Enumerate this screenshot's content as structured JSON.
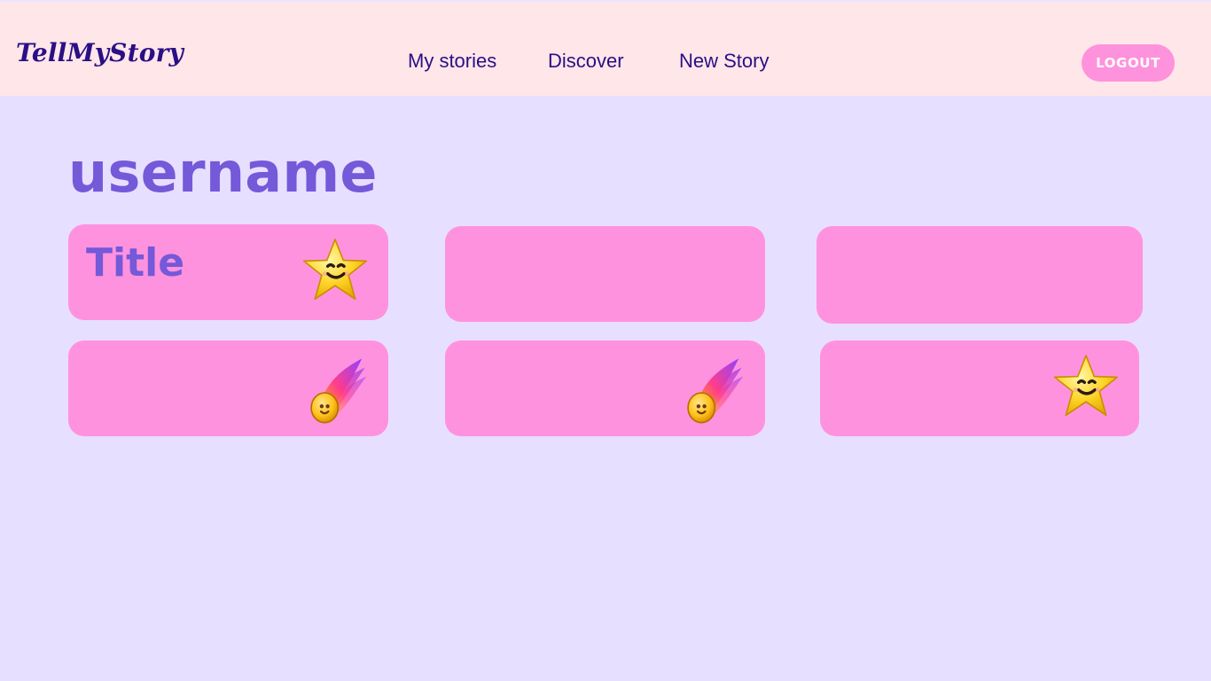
{
  "header": {
    "brand": "TellMyStory",
    "nav": {
      "my_stories": "My stories",
      "discover": "Discover",
      "new_story": "New Story"
    },
    "logout_label": "LOGOUT"
  },
  "profile": {
    "username": "username"
  },
  "stories": [
    {
      "title": "Title",
      "icon": "smiling-star-icon"
    },
    {
      "title": "",
      "icon": ""
    },
    {
      "title": "",
      "icon": ""
    },
    {
      "title": "",
      "icon": "shooting-star-comet-icon"
    },
    {
      "title": "",
      "icon": "shooting-star-comet-icon"
    },
    {
      "title": "",
      "icon": "smiling-star-icon"
    }
  ],
  "colors": {
    "header_bg": "#ffe6e8",
    "page_bg": "#e7dfff",
    "accent_purple": "#7459d9",
    "nav_text": "#2a0f86",
    "card_pink": "#ff92de"
  }
}
